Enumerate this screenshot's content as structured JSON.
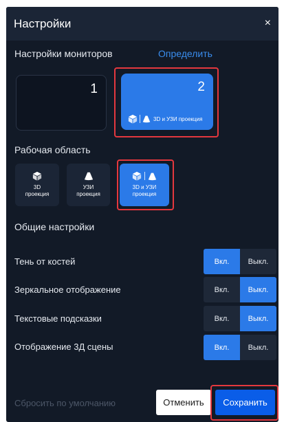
{
  "dialog": {
    "title": "Настройки",
    "close_glyph": "×"
  },
  "monitors": {
    "label": "Настройки мониторов",
    "identify_label": "Определить",
    "items": [
      {
        "number": "1",
        "selected": false
      },
      {
        "number": "2",
        "selected": true,
        "caption": "3D и УЗИ проекция"
      }
    ]
  },
  "workspace": {
    "label": "Рабочая область",
    "modes": [
      {
        "label": "3D\nпроекция",
        "icons": [
          "cube-icon"
        ],
        "selected": false
      },
      {
        "label": "УЗИ\nпроекция",
        "icons": [
          "ultrasound-icon"
        ],
        "selected": false
      },
      {
        "label": "3D и УЗИ\nпроекция",
        "icons": [
          "cube-icon",
          "ultrasound-icon"
        ],
        "selected": true
      }
    ]
  },
  "general": {
    "label": "Общие настройки",
    "rows": [
      {
        "label": "Тень от костей",
        "on_label": "Вкл.",
        "off_label": "Выкл.",
        "value": "on"
      },
      {
        "label": "Зеркальное отображение",
        "on_label": "Вкл.",
        "off_label": "Выкл.",
        "value": "off"
      },
      {
        "label": "Текстовые подсказки",
        "on_label": "Вкл.",
        "off_label": "Выкл.",
        "value": "off"
      },
      {
        "label": "Отображение 3Д сцены",
        "on_label": "Вкл.",
        "off_label": "Выкл.",
        "value": "on"
      }
    ]
  },
  "footer": {
    "reset_label": "Сбросить по умолчанию",
    "cancel_label": "Отменить",
    "save_label": "Сохранить"
  },
  "colors": {
    "panel_bg": "#121a27",
    "accent": "#2b7ae8",
    "save_button": "#0a5de8",
    "highlight": "#e5383e"
  }
}
